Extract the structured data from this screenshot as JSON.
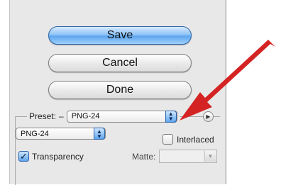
{
  "buttons": {
    "save_label": "Save",
    "cancel_label": "Cancel",
    "done_label": "Done"
  },
  "preset": {
    "label": "Preset:",
    "dash": "–",
    "selected": "PNG-24"
  },
  "format": {
    "selected": "PNG-24"
  },
  "options": {
    "interlaced_label": "Interlaced",
    "interlaced_checked": false,
    "transparency_label": "Transparency",
    "transparency_checked": true,
    "matte_label": "Matte:",
    "matte_value": ""
  },
  "icons": {
    "popup_arrows": "up-down-arrows-icon",
    "menu_circle": "right-triangle-in-circle-icon",
    "checkmark": "checkmark-icon",
    "annotation": "red-pointer-arrow-icon"
  },
  "colors": {
    "default_button": "#6aaef0",
    "annotation_arrow": "#d42323",
    "panel_bg": "#e8e8e8"
  }
}
